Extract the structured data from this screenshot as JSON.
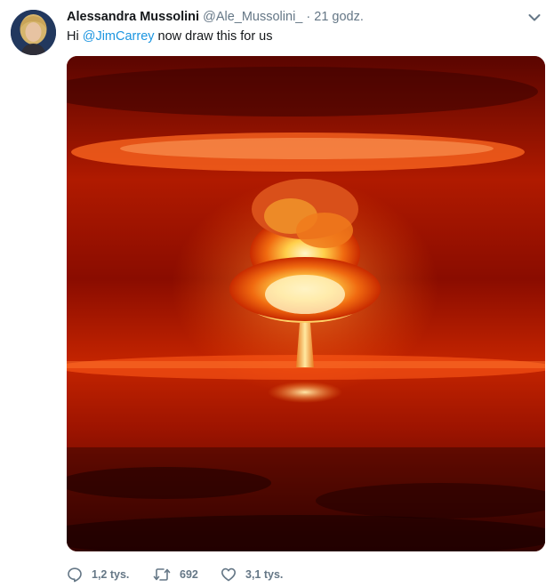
{
  "tweet": {
    "author_name": "Alessandra Mussolini",
    "handle": "@Ale_Mussolini_",
    "separator": "·",
    "time": "21 godz.",
    "text_prefix": "Hi ",
    "mention": "@JimCarrey",
    "text_suffix": " now draw this for us"
  },
  "actions": {
    "replies": "1,2 tys.",
    "retweets": "692",
    "likes": "3,1 tys."
  },
  "icons": {
    "menu": "chevron-down-icon",
    "reply": "reply-icon",
    "retweet": "retweet-icon",
    "like": "heart-icon"
  },
  "colors": {
    "text": "#14171a",
    "secondary": "#657786",
    "mention": "#1b95e0"
  }
}
